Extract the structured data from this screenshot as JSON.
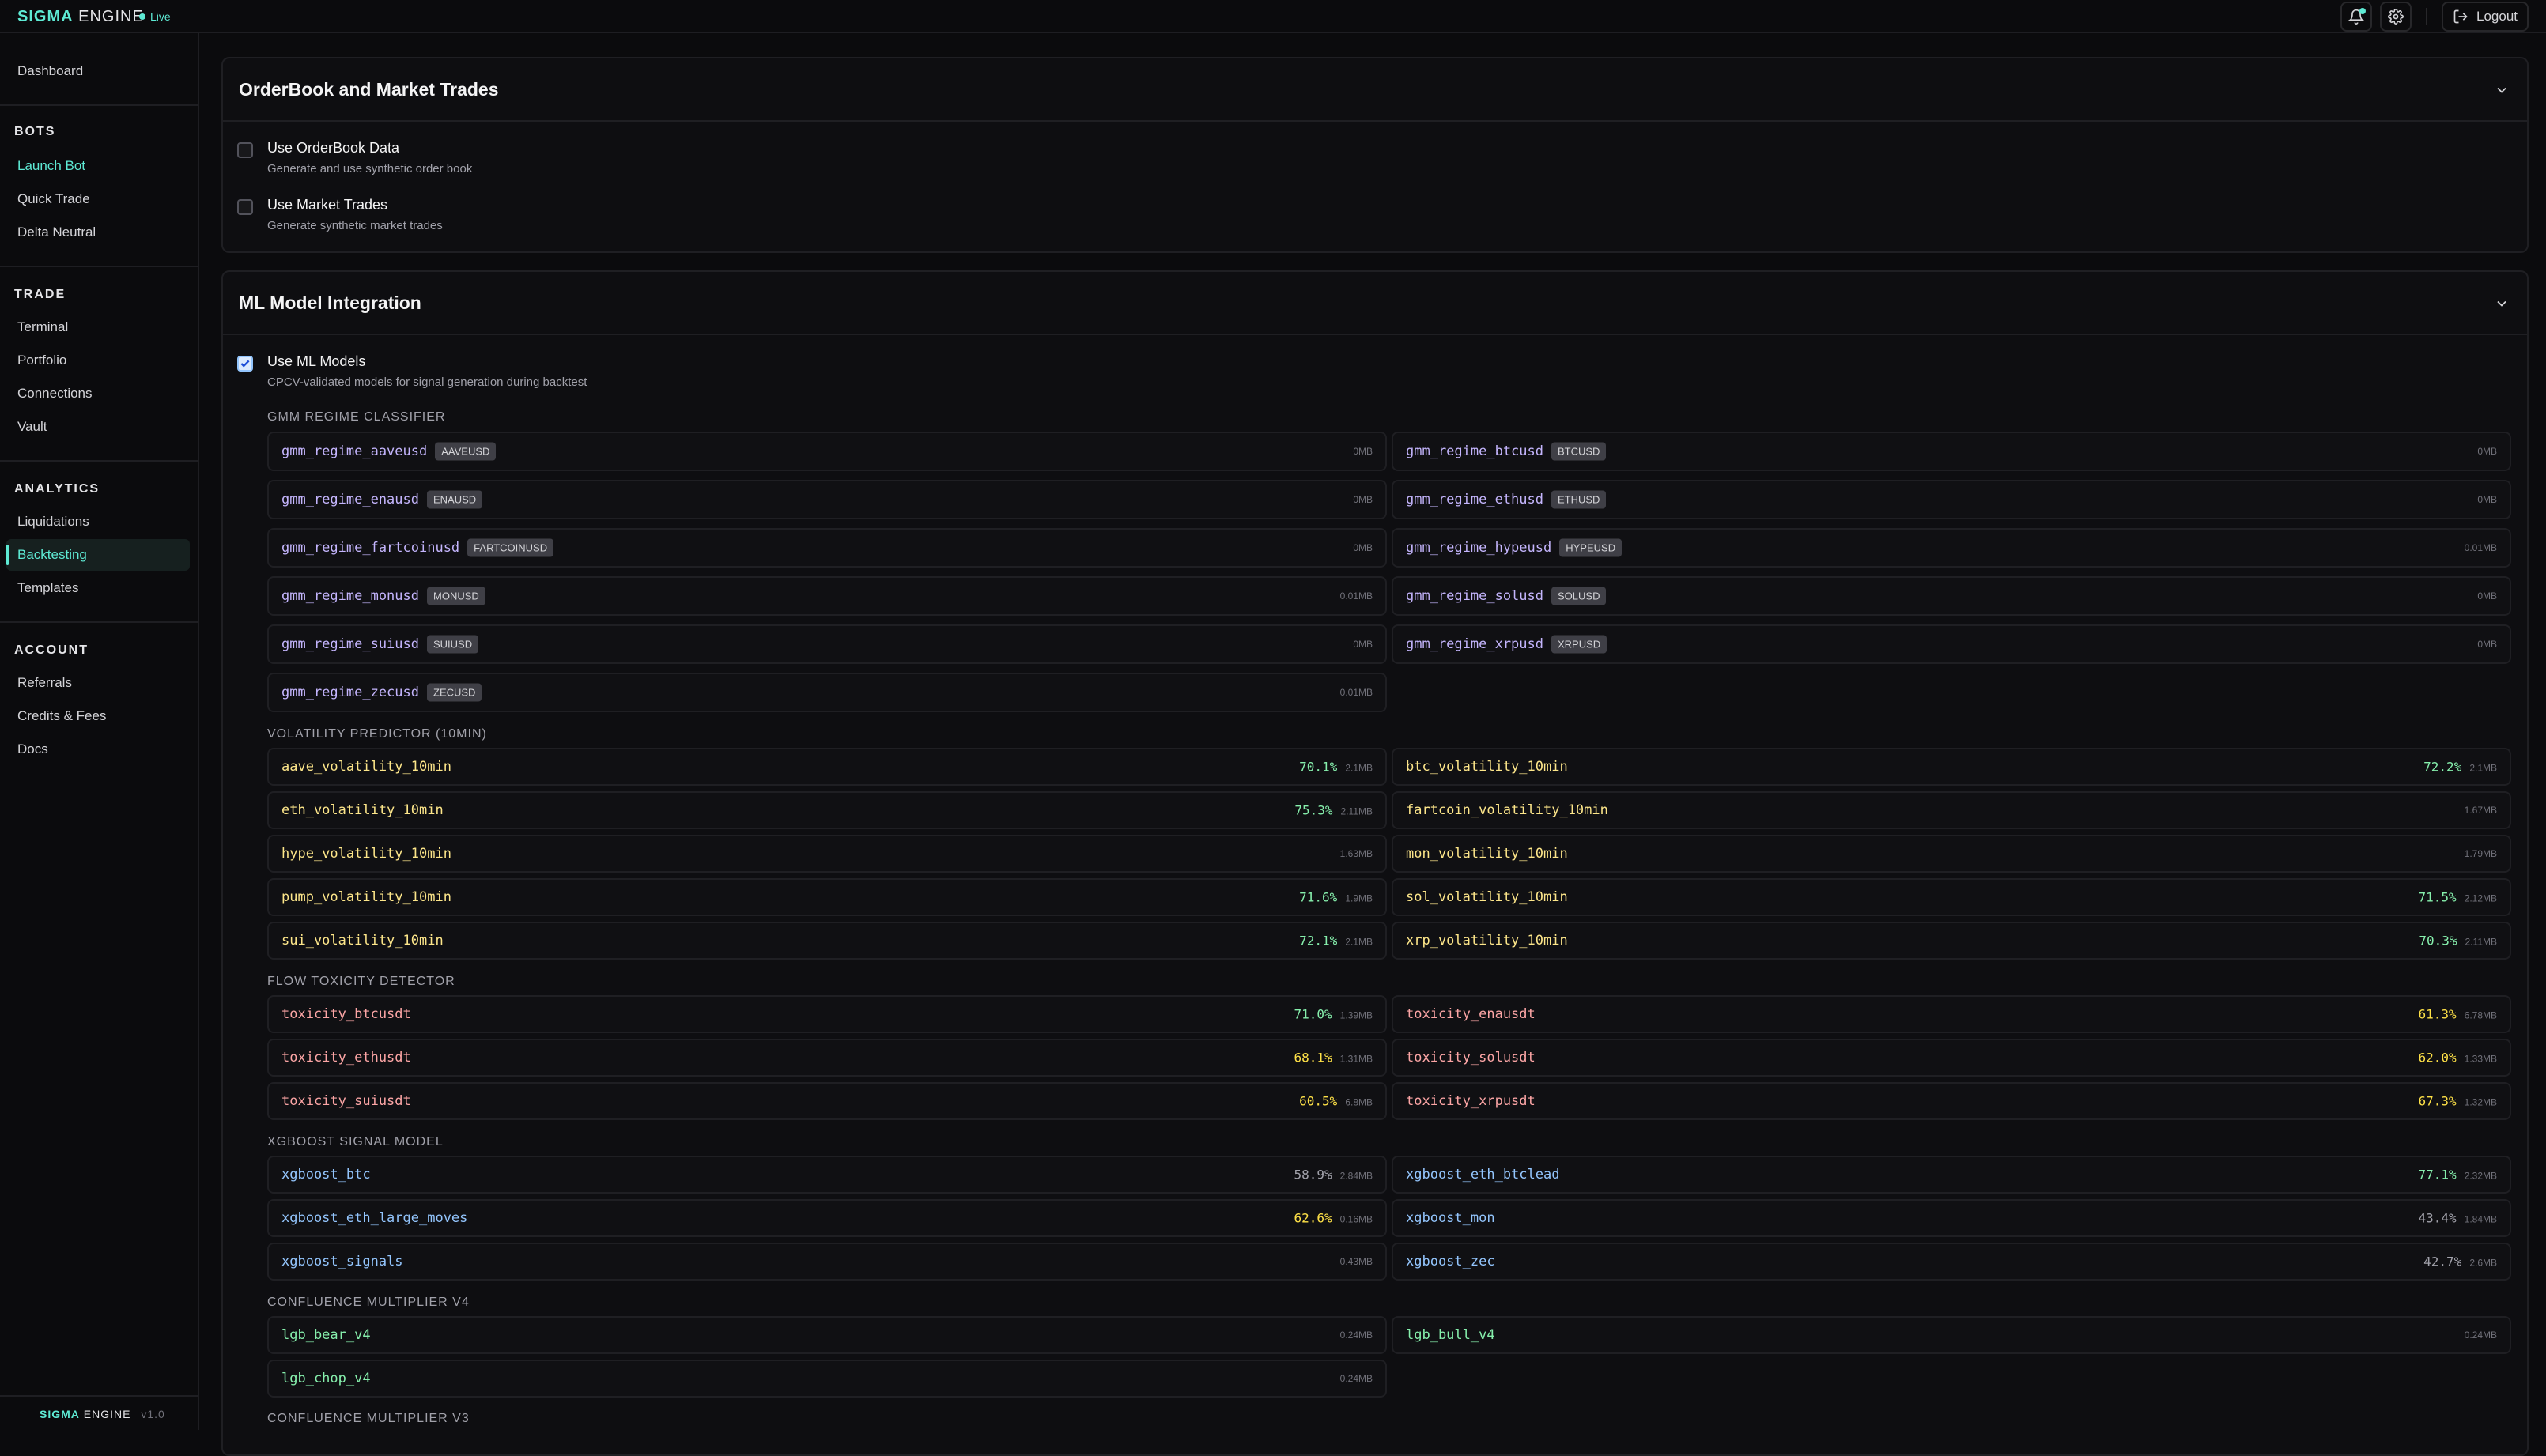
{
  "brand": {
    "sigma": "SIGMA",
    "engine": "ENGINE",
    "status": "Live",
    "version": "v1.0"
  },
  "topbar": {
    "logout_label": "Logout"
  },
  "sidebar": {
    "dashboard": "Dashboard",
    "sections": [
      {
        "title": "BOTS",
        "items": [
          "Launch Bot",
          "Quick Trade",
          "Delta Neutral"
        ]
      },
      {
        "title": "TRADE",
        "items": [
          "Terminal",
          "Portfolio",
          "Connections",
          "Vault"
        ]
      },
      {
        "title": "ANALYTICS",
        "items": [
          "Liquidations",
          "Backtesting",
          "Templates"
        ]
      },
      {
        "title": "ACCOUNT",
        "items": [
          "Referrals",
          "Credits & Fees",
          "Docs"
        ]
      }
    ]
  },
  "orderbook_panel": {
    "title": "OrderBook and Market Trades",
    "options": [
      {
        "title": "Use OrderBook Data",
        "desc": "Generate and use synthetic order book",
        "checked": false
      },
      {
        "title": "Use Market Trades",
        "desc": "Generate synthetic market trades",
        "checked": false
      }
    ]
  },
  "ml_panel": {
    "title": "ML Model Integration",
    "use_ml": {
      "title": "Use ML Models",
      "desc": "CPCV-validated models for signal generation during backtest",
      "checked": true
    },
    "gmm_label": "GMM REGIME CLASSIFIER",
    "gmm": [
      {
        "name": "gmm_regime_aaveusd",
        "badge": "AAVEUSD",
        "size": "0MB"
      },
      {
        "name": "gmm_regime_btcusd",
        "badge": "BTCUSD",
        "size": "0MB"
      },
      {
        "name": "gmm_regime_enausd",
        "badge": "ENAUSD",
        "size": "0MB"
      },
      {
        "name": "gmm_regime_ethusd",
        "badge": "ETHUSD",
        "size": "0MB"
      },
      {
        "name": "gmm_regime_fartcoinusd",
        "badge": "FARTCOINUSD",
        "size": "0MB"
      },
      {
        "name": "gmm_regime_hypeusd",
        "badge": "HYPEUSD",
        "size": "0.01MB"
      },
      {
        "name": "gmm_regime_monusd",
        "badge": "MONUSD",
        "size": "0.01MB"
      },
      {
        "name": "gmm_regime_solusd",
        "badge": "SOLUSD",
        "size": "0MB"
      },
      {
        "name": "gmm_regime_suiusd",
        "badge": "SUIUSD",
        "size": "0MB"
      },
      {
        "name": "gmm_regime_xrpusd",
        "badge": "XRPUSD",
        "size": "0MB"
      },
      {
        "name": "gmm_regime_zecusd",
        "badge": "ZECUSD",
        "size": "0.01MB"
      }
    ],
    "vol_label": "VOLATILITY PREDICTOR (10MIN)",
    "vol": [
      {
        "name": "aave_volatility_10min",
        "acc": "70.1%",
        "size": "2.1MB"
      },
      {
        "name": "btc_volatility_10min",
        "acc": "72.2%",
        "size": "2.1MB"
      },
      {
        "name": "eth_volatility_10min",
        "acc": "75.3%",
        "size": "2.11MB"
      },
      {
        "name": "fartcoin_volatility_10min",
        "acc": "",
        "size": "1.67MB"
      },
      {
        "name": "hype_volatility_10min",
        "acc": "",
        "size": "1.63MB"
      },
      {
        "name": "mon_volatility_10min",
        "acc": "",
        "size": "1.79MB"
      },
      {
        "name": "pump_volatility_10min",
        "acc": "71.6%",
        "size": "1.9MB"
      },
      {
        "name": "sol_volatility_10min",
        "acc": "71.5%",
        "size": "2.12MB"
      },
      {
        "name": "sui_volatility_10min",
        "acc": "72.1%",
        "size": "2.1MB"
      },
      {
        "name": "xrp_volatility_10min",
        "acc": "70.3%",
        "size": "2.11MB"
      }
    ],
    "tox_label": "FLOW TOXICITY DETECTOR",
    "tox": [
      {
        "name": "toxicity_btcusdt",
        "acc": "71.0%",
        "size": "1.39MB",
        "tone": "green"
      },
      {
        "name": "toxicity_enausdt",
        "acc": "61.3%",
        "size": "6.78MB",
        "tone": "yellow"
      },
      {
        "name": "toxicity_ethusdt",
        "acc": "68.1%",
        "size": "1.31MB",
        "tone": "yellow"
      },
      {
        "name": "toxicity_solusdt",
        "acc": "62.0%",
        "size": "1.33MB",
        "tone": "yellow"
      },
      {
        "name": "toxicity_suiusdt",
        "acc": "60.5%",
        "size": "6.8MB",
        "tone": "yellow"
      },
      {
        "name": "toxicity_xrpusdt",
        "acc": "67.3%",
        "size": "1.32MB",
        "tone": "yellow"
      }
    ],
    "xgb_label": "XGBOOST SIGNAL MODEL",
    "xgb": [
      {
        "name": "xgboost_btc",
        "acc": "58.9%",
        "size": "2.84MB",
        "tone": "gray"
      },
      {
        "name": "xgboost_eth_btclead",
        "acc": "77.1%",
        "size": "2.32MB",
        "tone": "green"
      },
      {
        "name": "xgboost_eth_large_moves",
        "acc": "62.6%",
        "size": "0.16MB",
        "tone": "yellow"
      },
      {
        "name": "xgboost_mon",
        "acc": "43.4%",
        "size": "1.84MB",
        "tone": "gray"
      },
      {
        "name": "xgboost_signals",
        "acc": "",
        "size": "0.43MB",
        "tone": "gray"
      },
      {
        "name": "xgboost_zec",
        "acc": "42.7%",
        "size": "2.6MB",
        "tone": "gray"
      }
    ],
    "lgb4_label": "CONFLUENCE MULTIPLIER V4",
    "lgb4": [
      {
        "name": "lgb_bear_v4",
        "size": "0.24MB"
      },
      {
        "name": "lgb_bull_v4",
        "size": "0.24MB"
      },
      {
        "name": "lgb_chop_v4",
        "size": "0.24MB"
      }
    ],
    "lgb3_label": "CONFLUENCE MULTIPLIER V3"
  },
  "colors": {
    "accent": "#5eead4",
    "bg": "#0b0b0d"
  }
}
